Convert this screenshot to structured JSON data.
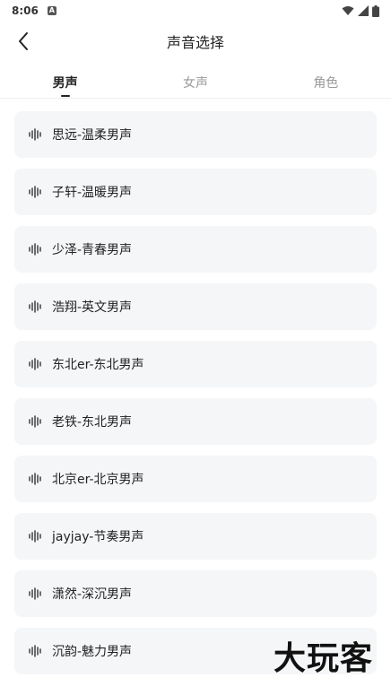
{
  "status": {
    "time": "8:06",
    "a_glyph": "A"
  },
  "header": {
    "title": "声音选择"
  },
  "tabs": [
    {
      "label": "男声",
      "active": true
    },
    {
      "label": "女声",
      "active": false
    },
    {
      "label": "角色",
      "active": false
    }
  ],
  "voices": [
    {
      "label": "思远-温柔男声"
    },
    {
      "label": "子轩-温暖男声"
    },
    {
      "label": "少泽-青春男声"
    },
    {
      "label": "浩翔-英文男声"
    },
    {
      "label": "东北er-东北男声"
    },
    {
      "label": "老铁-东北男声"
    },
    {
      "label": "北京er-北京男声"
    },
    {
      "label": "jayjay-节奏男声"
    },
    {
      "label": "潇然-深沉男声"
    },
    {
      "label": "沉韵-魅力男声"
    }
  ],
  "watermark": "大玩客",
  "icons": {
    "back": "chevron-left-icon",
    "voice": "waveform-icon",
    "wifi": "wifi-icon",
    "signal": "signal-icon",
    "battery": "battery-icon"
  }
}
